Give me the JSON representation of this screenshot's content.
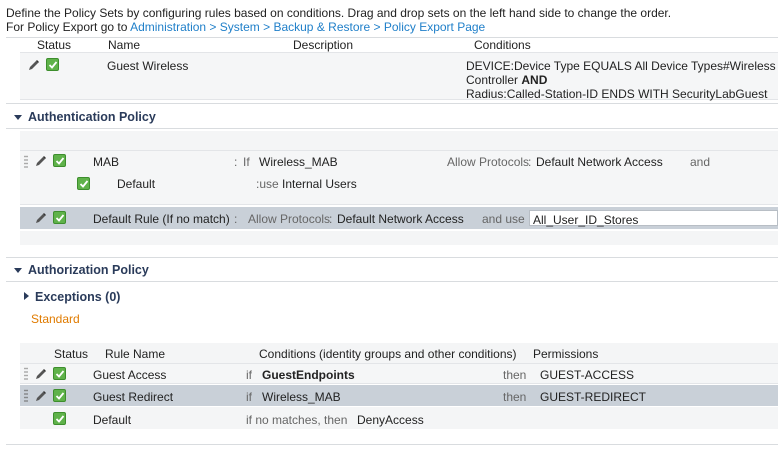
{
  "intro": {
    "line1": "Define the Policy Sets by configuring rules based on conditions. Drag and drop sets on the left hand side to change the order.",
    "line2_prefix": "For Policy Export go to ",
    "line2_link": "Administration > System > Backup & Restore > Policy Export Page"
  },
  "policy_sets": {
    "headers": {
      "status": "Status",
      "name": "Name",
      "description": "Description",
      "conditions": "Conditions"
    },
    "row": {
      "name": "Guest Wireless",
      "cond_line1": "DEVICE:Device Type EQUALS All Device Types#Wireless",
      "cond_line2a": "Controller ",
      "cond_line2b": "AND",
      "cond_line3": "Radius:Called-Station-ID ENDS WITH SecurityLabGuest"
    }
  },
  "authentication": {
    "title": "Authentication Policy",
    "rule1": {
      "name": "MAB",
      "colon": ":",
      "if_label": "If",
      "condition": "Wireless_MAB",
      "allow_label": "Allow Protocols",
      "colon2": ":",
      "protocols": "Default Network Access",
      "and_label": "and"
    },
    "sub_rule": {
      "name": "Default",
      "use_label": ":use",
      "identity": "Internal Users"
    },
    "default_rule": {
      "name": "Default Rule (If no match)",
      "colon": ":",
      "allow_label": "Allow Protocols",
      "colon2": ":",
      "protocols": "Default Network Access",
      "and_use_label": "and use :",
      "identity": "All_User_ID_Stores"
    }
  },
  "authorization": {
    "title": "Authorization Policy",
    "exceptions": "Exceptions (0)",
    "standard": "Standard",
    "headers": {
      "status": "Status",
      "rule_name": "Rule Name",
      "conditions": "Conditions (identity groups and other conditions)",
      "permissions": "Permissions"
    },
    "rules": [
      {
        "name": "Guest Access",
        "if_label": "if",
        "condition": "GuestEndpoints",
        "then_label": "then",
        "permission": "GUEST-ACCESS"
      },
      {
        "name": "Guest Redirect",
        "if_label": "if",
        "condition": "Wireless_MAB",
        "then_label": "then",
        "permission": "GUEST-REDIRECT"
      },
      {
        "name": "Default",
        "if_label": "if no matches, then",
        "condition": "",
        "then_label": "",
        "permission": "DenyAccess"
      }
    ]
  },
  "colors": {
    "link": "#1f7fc9",
    "standard": "#e07b00",
    "section_title": "#2a3b5a",
    "checkbox_green": "#5fb24a",
    "selected_row": "#c9d0d8"
  }
}
